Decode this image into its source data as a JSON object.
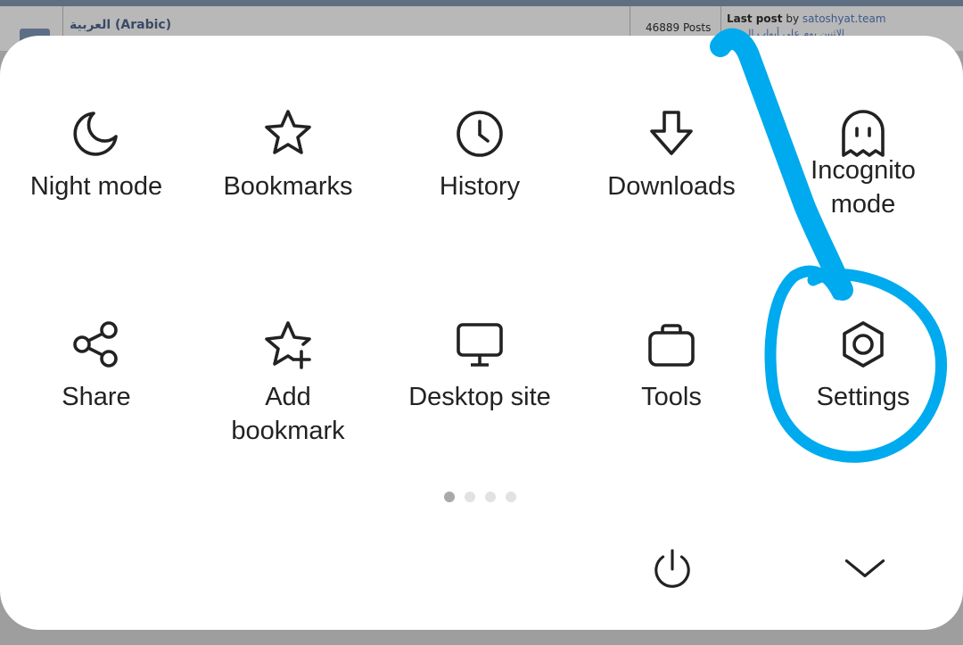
{
  "background_page": {
    "forum_name": "العربية (Arabic)",
    "posts": "46889 Posts",
    "last_post_label": "Last post",
    "last_post_by": "by",
    "last_post_user": "satoshyat.team",
    "last_post_topic": "...الاثنين بوم على أبواب الص"
  },
  "menu": {
    "items": [
      {
        "label": "Night mode",
        "icon": "moon-icon"
      },
      {
        "label": "Bookmarks",
        "icon": "star-icon"
      },
      {
        "label": "History",
        "icon": "clock-icon"
      },
      {
        "label": "Downloads",
        "icon": "download-arrow-icon"
      },
      {
        "label": "Incognito\nmode",
        "icon": "ghost-icon"
      },
      {
        "label": "Share",
        "icon": "share-icon"
      },
      {
        "label": "Add\nbookmark",
        "icon": "star-plus-icon"
      },
      {
        "label": "Desktop site",
        "icon": "monitor-icon"
      },
      {
        "label": "Tools",
        "icon": "toolbox-icon"
      },
      {
        "label": "Settings",
        "icon": "gear-icon"
      }
    ],
    "page_dots": {
      "count": 4,
      "active": 1
    },
    "bottom": {
      "power_icon": "power-icon",
      "collapse_icon": "chevron-down-icon"
    }
  },
  "annotation": {
    "color": "#00aaee",
    "icon": "hand-drawn-highlight"
  }
}
